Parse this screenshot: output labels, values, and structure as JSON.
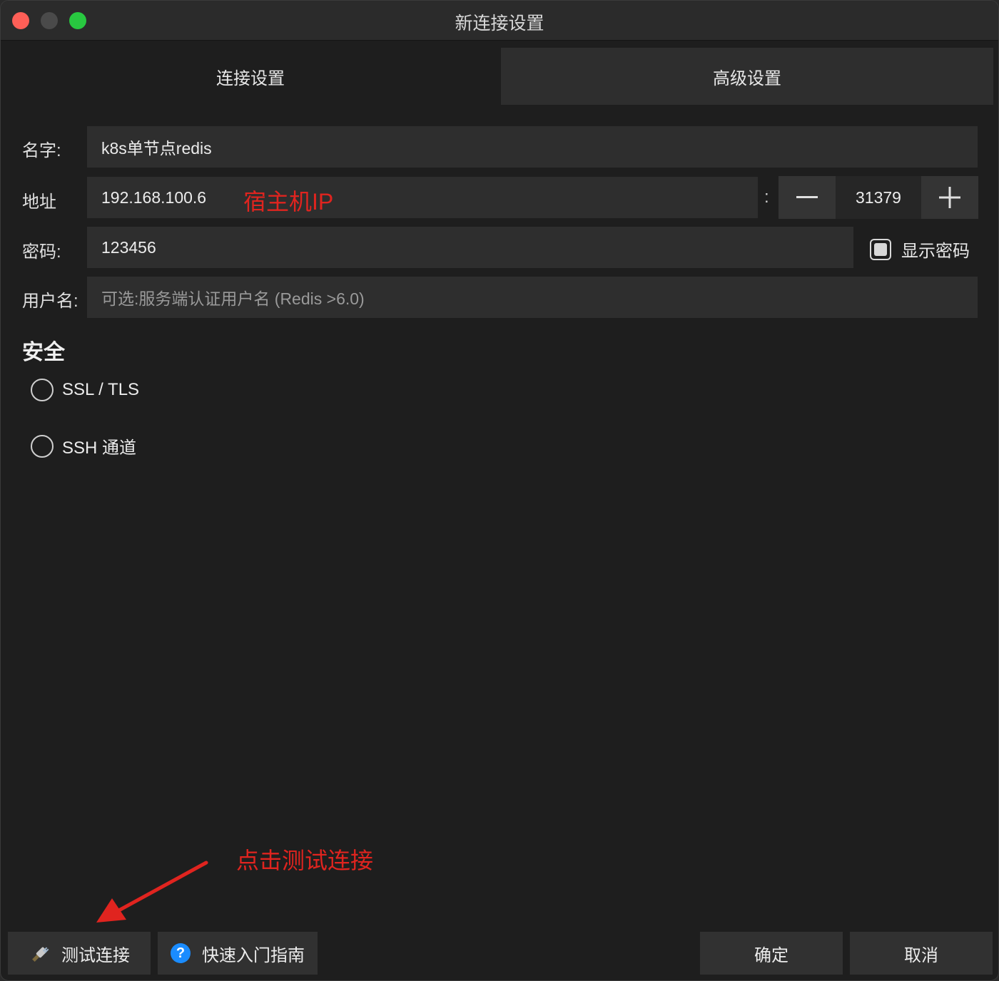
{
  "window": {
    "title": "新连接设置"
  },
  "tabs": [
    {
      "label": "连接设置",
      "active": true
    },
    {
      "label": "高级设置",
      "active": false
    }
  ],
  "form": {
    "name": {
      "label": "名字:",
      "value": "k8s单节点redis"
    },
    "address": {
      "label": "地址",
      "value": "192.168.100.6",
      "separator": ":"
    },
    "port": {
      "value": "31379",
      "decrement_icon": "minus-icon",
      "increment_icon": "plus-icon"
    },
    "password": {
      "label": "密码:",
      "value": "123456"
    },
    "show_password": {
      "label": "显示密码",
      "checked": true
    },
    "username": {
      "label": "用户名:",
      "value": "",
      "placeholder": "可选:服务端认证用户名 (Redis >6.0)"
    }
  },
  "security": {
    "title": "安全",
    "options": [
      {
        "label": "SSL / TLS",
        "checked": false
      },
      {
        "label": "SSH 通道",
        "checked": false
      }
    ]
  },
  "annotations": {
    "host_ip": "宿主机IP",
    "click_test": "点击测试连接",
    "color": "#e0241f"
  },
  "buttons": {
    "test": {
      "label": "测试连接",
      "icon": "plug-icon"
    },
    "guide": {
      "label": "快速入门指南",
      "icon": "help-icon",
      "icon_glyph": "?"
    },
    "ok": {
      "label": "确定"
    },
    "cancel": {
      "label": "取消"
    }
  },
  "colors": {
    "background": "#1e1e1e",
    "field": "#2e2e2e",
    "traffic_close": "#fe5f57",
    "traffic_max": "#28c840",
    "help_blue": "#1a8cff"
  }
}
